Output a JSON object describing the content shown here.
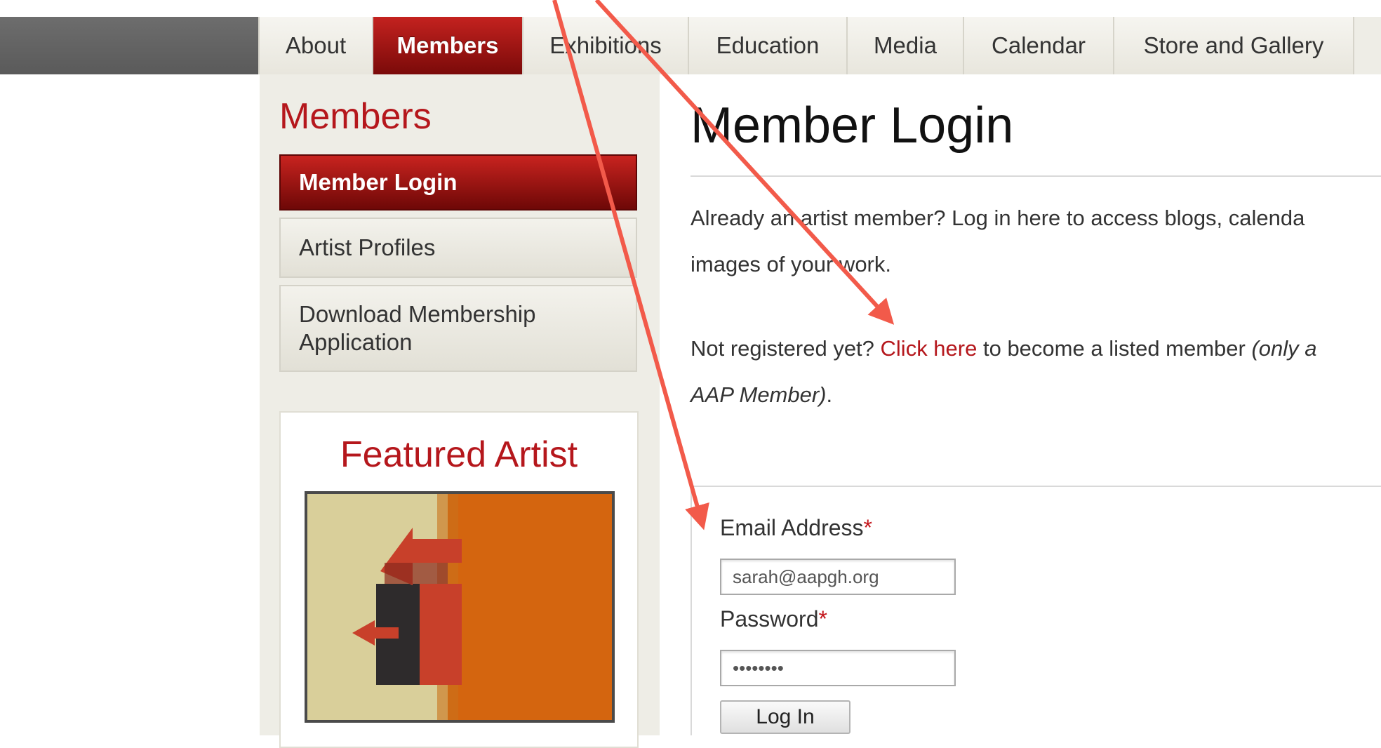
{
  "nav": {
    "tabs": [
      {
        "label": "About",
        "active": false
      },
      {
        "label": "Members",
        "active": true
      },
      {
        "label": "Exhibitions",
        "active": false
      },
      {
        "label": "Education",
        "active": false
      },
      {
        "label": "Media",
        "active": false
      },
      {
        "label": "Calendar",
        "active": false
      },
      {
        "label": "Store and Gallery",
        "active": false
      }
    ]
  },
  "sidebar": {
    "title": "Members",
    "items": [
      {
        "label": "Member Login",
        "active": true
      },
      {
        "label": "Artist Profiles",
        "active": false
      },
      {
        "label": "Download Membership",
        "label_line2": "Application",
        "active": false
      }
    ],
    "featured": {
      "title": "Featured Artist"
    }
  },
  "main": {
    "title": "Member Login",
    "intro_line1": "Already an artist member?  Log in here to access blogs, calenda",
    "intro_line2": "images of your work.",
    "register_prefix": "Not registered yet? ",
    "register_link": "Click here",
    "register_suffix": " to become a listed member ",
    "register_italic1": "(only a",
    "register_italic2": "AAP Member)",
    "register_end": ".",
    "form": {
      "email_label": "Email Address",
      "email_value": "sarah@aapgh.org",
      "password_label": "Password",
      "password_value": "••••••••",
      "required_mark": "*",
      "submit_label": "Log In"
    }
  },
  "colors": {
    "accent_red": "#b5171c",
    "annotation_arrow": "#f25a4a"
  }
}
